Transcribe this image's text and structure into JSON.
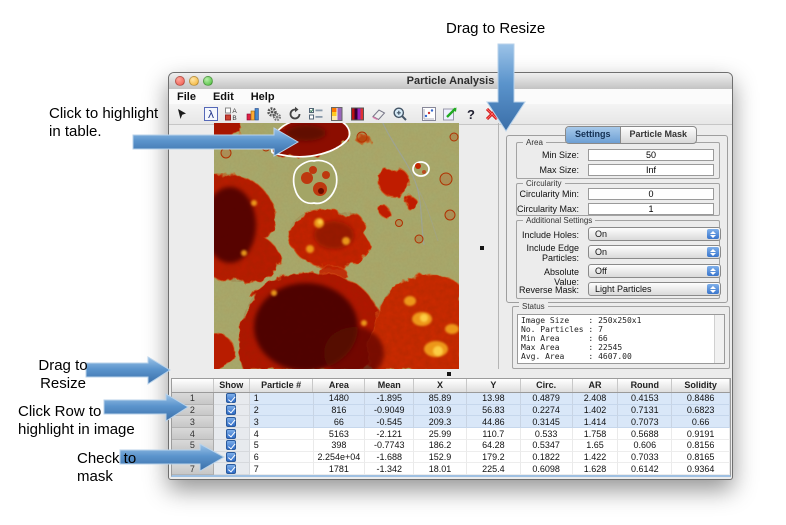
{
  "annotations": {
    "drag_resize_top": "Drag to Resize",
    "click_highlight": [
      "Click to highlight",
      "in table."
    ],
    "drag_resize_left": [
      "Drag to",
      "Resize"
    ],
    "click_row": [
      "Click Row to",
      "highlight in image"
    ],
    "check_mask": [
      "Check to",
      "mask"
    ]
  },
  "window": {
    "title": "Particle Analysis",
    "menus": [
      "File",
      "Edit",
      "Help"
    ],
    "toolbar": [
      "cursor-arrow",
      "lambda",
      "compare-ab",
      "histogram",
      "gears",
      "refresh",
      "checklist",
      "colorbar",
      "colormap",
      "eraser",
      "zoom",
      "plot",
      "export",
      "help",
      "delete"
    ]
  },
  "panel": {
    "tabs": {
      "settings": "Settings",
      "particle_mask": "Particle Mask",
      "selected": "Settings"
    },
    "area": {
      "label": "Area",
      "min_label": "Min Size:",
      "min_value": "50",
      "max_label": "Max Size:",
      "max_value": "Inf"
    },
    "circularity": {
      "label": "Circularity",
      "min_label": "Circularity Min:",
      "min_value": "0",
      "max_label": "Circularity Max:",
      "max_value": "1"
    },
    "additional": {
      "label": "Additional Settings",
      "rows": [
        {
          "label": "Include Holes:",
          "value": "On"
        },
        {
          "label": "Include Edge Particles:",
          "value": "On"
        },
        {
          "label": "Absolute Value:",
          "value": "Off"
        },
        {
          "label": "Reverse Mask:",
          "value": "Light Particles"
        }
      ]
    },
    "status": {
      "label": "Status",
      "lines": [
        "Image Size    : 250x250x1",
        "No. Particles : 7",
        "Min Area      : 66",
        "Max Area      : 22545",
        "Avg. Area     : 4607.00"
      ]
    }
  },
  "table": {
    "columns": [
      "",
      "Show",
      "Particle #",
      "Area",
      "Mean",
      "X",
      "Y",
      "Circ.",
      "AR",
      "Round",
      "Solidity"
    ],
    "rows": [
      {
        "num": "1",
        "checked": true,
        "selected": true,
        "values": [
          "1",
          "1480",
          "-1.895",
          "85.89",
          "13.98",
          "0.4879",
          "2.408",
          "0.4153",
          "0.8486"
        ]
      },
      {
        "num": "2",
        "checked": true,
        "selected": true,
        "values": [
          "2",
          "816",
          "-0.9049",
          "103.9",
          "56.83",
          "0.2274",
          "1.402",
          "0.7131",
          "0.6823"
        ]
      },
      {
        "num": "3",
        "checked": true,
        "selected": true,
        "values": [
          "3",
          "66",
          "-0.545",
          "209.3",
          "44.86",
          "0.3145",
          "1.414",
          "0.7073",
          "0.66"
        ]
      },
      {
        "num": "4",
        "checked": true,
        "selected": false,
        "values": [
          "4",
          "5163",
          "-2.121",
          "25.99",
          "110.7",
          "0.533",
          "1.758",
          "0.5688",
          "0.9191"
        ]
      },
      {
        "num": "5",
        "checked": true,
        "selected": false,
        "values": [
          "5",
          "398",
          "-0.7743",
          "186.2",
          "64.28",
          "0.5347",
          "1.65",
          "0.606",
          "0.8156"
        ]
      },
      {
        "num": "6",
        "checked": true,
        "selected": false,
        "values": [
          "6",
          "2.254e+04",
          "-1.688",
          "152.9",
          "179.2",
          "0.1822",
          "1.422",
          "0.7033",
          "0.8165"
        ]
      },
      {
        "num": "7",
        "checked": true,
        "selected": false,
        "values": [
          "7",
          "1781",
          "-1.342",
          "18.01",
          "225.4",
          "0.6098",
          "1.628",
          "0.6142",
          "0.9364"
        ]
      }
    ]
  },
  "colors": {
    "annotation_arrow": "#4f8fca",
    "selected_row": "#d9e7f8",
    "tab_selected": "#8ab6e1",
    "checkbox_blue": "#3b74c9",
    "heat_red": "#c02000",
    "heat_dark": "#4e0700",
    "heat_yellow": "#f2a41f",
    "background_olive": "#a8ab6e"
  }
}
